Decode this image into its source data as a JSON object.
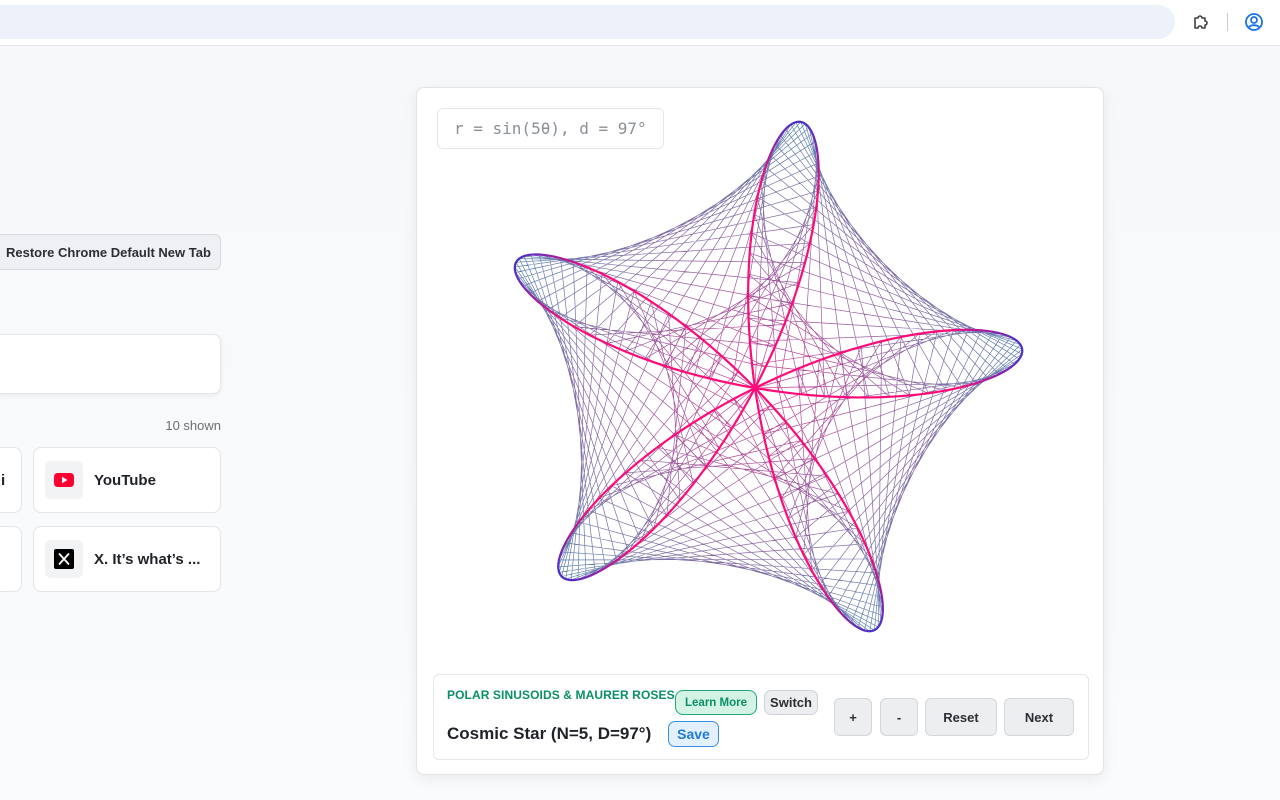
{
  "browser": {
    "extensions_icon": "puzzle-icon",
    "profile_icon": "account-circle-icon"
  },
  "newtab": {
    "restore_button": "Restore Chrome Default New Tab",
    "shortcuts_count": "10 shown",
    "shortcuts": [
      {
        "label": "i",
        "icon": "generic-site-icon"
      },
      {
        "label": "YouTube",
        "icon": "youtube-icon"
      },
      {
        "label": "",
        "icon": "generic-site-icon"
      },
      {
        "label": "X. It’s what’s ...",
        "icon": "x-logo-icon"
      }
    ]
  },
  "rose_card": {
    "formula": "r = sin(5θ), d = 97°",
    "parameters": {
      "n": 5,
      "d": 97
    },
    "colors": {
      "outline": "#4b2fc9",
      "petals": "#ff0a78",
      "web_a": "#3d6fa0",
      "web_b": "#c2187d"
    },
    "controls": {
      "category": "POLAR SINUSOIDS & MAURER ROSES",
      "learn_more": "Learn More",
      "switch": "Switch",
      "name": "Cosmic Star (N=5, D=97°)",
      "save": "Save",
      "plus": "+",
      "minus": "-",
      "reset": "Reset",
      "next": "Next"
    }
  }
}
